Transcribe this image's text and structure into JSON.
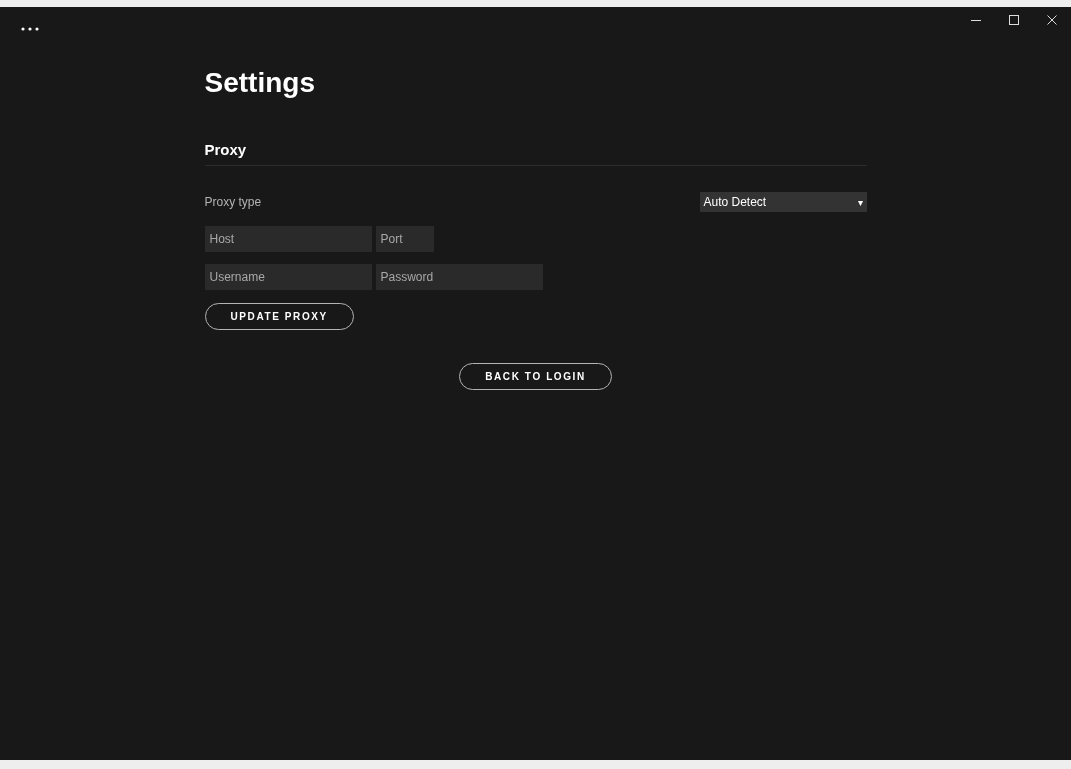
{
  "page": {
    "title": "Settings"
  },
  "proxy": {
    "heading": "Proxy",
    "type_label": "Proxy type",
    "type_value": "Auto Detect",
    "dropdown_caret": "▾",
    "field_rows": [
      [
        {
          "placeholder": "Host",
          "kind": "wide"
        },
        {
          "placeholder": "Port",
          "kind": "narrow"
        }
      ],
      [
        {
          "placeholder": "Username",
          "kind": "wide"
        },
        {
          "placeholder": "Password",
          "kind": "wide"
        }
      ]
    ],
    "update_button": "UPDATE PROXY"
  },
  "back_button": "BACK TO LOGIN"
}
